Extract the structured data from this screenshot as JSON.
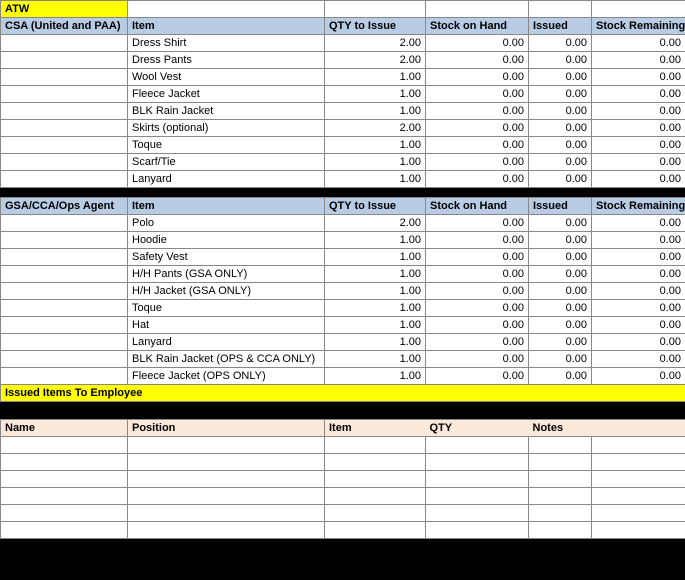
{
  "title": "ATW",
  "section1": {
    "label": "CSA (United and PAA)",
    "headers": {
      "item": "Item",
      "qty": "QTY to Issue",
      "stock": "Stock on Hand",
      "issued": "Issued",
      "remain": "Stock Remaining"
    },
    "rows": [
      {
        "item": "Dress Shirt",
        "qty": "2.00",
        "stock": "0.00",
        "issued": "0.00",
        "remain": "0.00"
      },
      {
        "item": "Dress Pants",
        "qty": "2.00",
        "stock": "0.00",
        "issued": "0.00",
        "remain": "0.00"
      },
      {
        "item": "Wool Vest",
        "qty": "1.00",
        "stock": "0.00",
        "issued": "0.00",
        "remain": "0.00"
      },
      {
        "item": "Fleece Jacket",
        "qty": "1.00",
        "stock": "0.00",
        "issued": "0.00",
        "remain": "0.00"
      },
      {
        "item": "BLK Rain Jacket",
        "qty": "1.00",
        "stock": "0.00",
        "issued": "0.00",
        "remain": "0.00"
      },
      {
        "item": "Skirts (optional)",
        "qty": "2.00",
        "stock": "0.00",
        "issued": "0.00",
        "remain": "0.00"
      },
      {
        "item": "Toque",
        "qty": "1.00",
        "stock": "0.00",
        "issued": "0.00",
        "remain": "0.00"
      },
      {
        "item": "Scarf/Tie",
        "qty": "1.00",
        "stock": "0.00",
        "issued": "0.00",
        "remain": "0.00"
      },
      {
        "item": "Lanyard",
        "qty": "1.00",
        "stock": "0.00",
        "issued": "0.00",
        "remain": "0.00"
      }
    ]
  },
  "section2": {
    "label": "GSA/CCA/Ops Agent",
    "headers": {
      "item": "Item",
      "qty": "QTY to Issue",
      "stock": "Stock on Hand",
      "issued": "Issued",
      "remain": "Stock Remaining"
    },
    "rows": [
      {
        "item": "Polo",
        "qty": "2.00",
        "stock": "0.00",
        "issued": "0.00",
        "remain": "0.00"
      },
      {
        "item": "Hoodie",
        "qty": "1.00",
        "stock": "0.00",
        "issued": "0.00",
        "remain": "0.00"
      },
      {
        "item": "Safety Vest",
        "qty": "1.00",
        "stock": "0.00",
        "issued": "0.00",
        "remain": "0.00"
      },
      {
        "item": "H/H Pants (GSA ONLY)",
        "qty": "1.00",
        "stock": "0.00",
        "issued": "0.00",
        "remain": "0.00"
      },
      {
        "item": "H/H Jacket (GSA ONLY)",
        "qty": "1.00",
        "stock": "0.00",
        "issued": "0.00",
        "remain": "0.00"
      },
      {
        "item": "Toque",
        "qty": "1.00",
        "stock": "0.00",
        "issued": "0.00",
        "remain": "0.00"
      },
      {
        "item": "Hat",
        "qty": "1.00",
        "stock": "0.00",
        "issued": "0.00",
        "remain": "0.00"
      },
      {
        "item": "Lanyard",
        "qty": "1.00",
        "stock": "0.00",
        "issued": "0.00",
        "remain": "0.00"
      },
      {
        "item": "BLK Rain Jacket (OPS & CCA ONLY)",
        "qty": "1.00",
        "stock": "0.00",
        "issued": "0.00",
        "remain": "0.00"
      },
      {
        "item": "Fleece Jacket (OPS ONLY)",
        "qty": "1.00",
        "stock": "0.00",
        "issued": "0.00",
        "remain": "0.00"
      }
    ]
  },
  "issued": {
    "title": "Issued Items To Employee",
    "headers": {
      "name": "Name",
      "position": "Position",
      "item": "Item",
      "qty": "QTY",
      "notes": "Notes"
    },
    "rows": [
      "",
      "",
      "",
      "",
      "",
      ""
    ]
  }
}
